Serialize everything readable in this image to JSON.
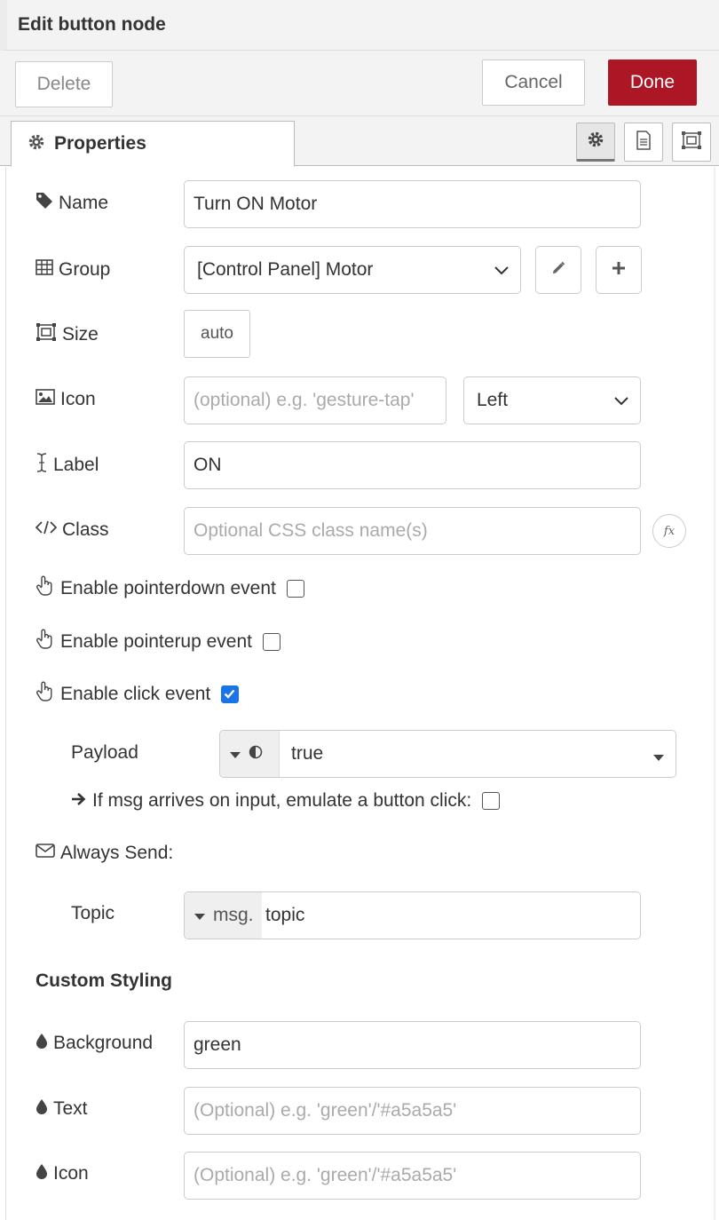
{
  "dialog": {
    "title": "Edit button node"
  },
  "toolbar": {
    "delete_label": "Delete",
    "cancel_label": "Cancel",
    "done_label": "Done"
  },
  "tabs": [
    {
      "label": "Properties",
      "icon": "gear-icon"
    }
  ],
  "tab_buttons": [
    "gear-icon",
    "document-icon",
    "appearance-icon"
  ],
  "form": {
    "name": {
      "label": "Name",
      "value": "Turn ON Motor"
    },
    "group": {
      "label": "Group",
      "value": "[Control Panel] Motor"
    },
    "size": {
      "label": "Size",
      "value": "auto"
    },
    "icon": {
      "label": "Icon",
      "placeholder": "(optional) e.g. 'gesture-tap'",
      "position": "Left"
    },
    "text_label": {
      "label": "Label",
      "value": "ON"
    },
    "class": {
      "label": "Class",
      "placeholder": "Optional CSS class name(s)",
      "fx": "fx"
    },
    "pointerdown": {
      "label": "Enable pointerdown event",
      "checked": false
    },
    "pointerup": {
      "label": "Enable pointerup event",
      "checked": false
    },
    "click": {
      "label": "Enable click event",
      "checked": true
    },
    "payload": {
      "label": "Payload",
      "value": "true"
    },
    "emulate": {
      "label": "If msg arrives on input, emulate a button click:",
      "checked": false
    },
    "always_send": {
      "label": "Always Send:"
    },
    "topic": {
      "label": "Topic",
      "prefix": "msg.",
      "value": "topic"
    },
    "custom_styling": {
      "title": "Custom Styling"
    },
    "background": {
      "label": "Background",
      "value": "green"
    },
    "text_color": {
      "label": "Text",
      "placeholder": "(Optional) e.g. 'green'/'#a5a5a5'"
    },
    "icon_color": {
      "label": "Icon",
      "placeholder": "(Optional) e.g. 'green'/'#a5a5a5'"
    }
  },
  "colors": {
    "done": "#ad1625",
    "checkbox_checked": "#1a73e8"
  }
}
